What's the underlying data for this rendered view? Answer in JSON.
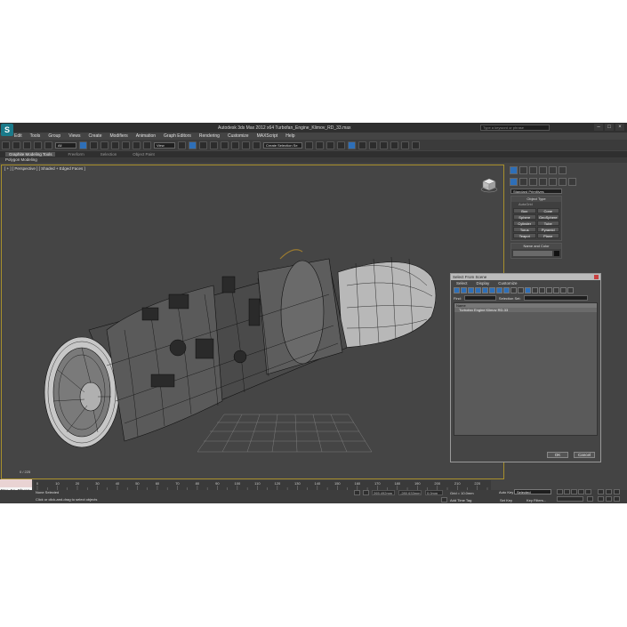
{
  "window": {
    "title": "Autodesk 3ds Max 2012 x64    Turbofan_Engine_Klimov_RD_33.max",
    "search_placeholder": "Type a keyword or phrase",
    "logo": "S"
  },
  "menu": [
    "Edit",
    "Tools",
    "Group",
    "Views",
    "Create",
    "Modifiers",
    "Animation",
    "Graph Editors",
    "Rendering",
    "Customize",
    "MAXScript",
    "Help"
  ],
  "toolbar": {
    "filter_dropdown": "All",
    "coord_dropdown": "View",
    "selection_set": "Create Selection Se"
  },
  "ribbon": {
    "tabs": [
      "Graphite Modeling Tools",
      "Freeform",
      "Selection",
      "Object Paint"
    ],
    "active_tab": 0,
    "sub_label": "Polygon Modeling"
  },
  "viewport": {
    "label": "[ + ] [ Perspective ] [ Shaded + Edged Faces ]",
    "frame_counter": "0 / 225"
  },
  "command_panel": {
    "category_dropdown": "Standard Primitives",
    "object_type_header": "Object Type",
    "autogrid": "AutoGrid",
    "buttons": [
      "Box",
      "Cone",
      "Sphere",
      "GeoSphere",
      "Cylinder",
      "Tube",
      "Torus",
      "Pyramid",
      "Teapot",
      "Plane"
    ],
    "name_color_header": "Name and Color"
  },
  "select_dialog": {
    "title": "Select From Scene",
    "menu": [
      "Select",
      "Display",
      "Customize"
    ],
    "find_label": "Find:",
    "selection_set_label": "Selection Set:",
    "column_header": "Name",
    "items": [
      "Turbofan Engine Klimov RD-33"
    ],
    "ok": "OK",
    "cancel": "Cancel"
  },
  "timeline": {
    "ticks": [
      "0",
      "10",
      "20",
      "30",
      "40",
      "50",
      "60",
      "70",
      "80",
      "90",
      "100",
      "110",
      "120",
      "130",
      "140",
      "150",
      "160",
      "170",
      "180",
      "190",
      "200",
      "210",
      "220"
    ]
  },
  "status": {
    "maxscript_text": "Max to Physc",
    "selection_info": "None Selected",
    "prompt": "Click or click-and-drag to select objects",
    "x_field": "265.492mm",
    "y_field": "-280.633mm",
    "z_field": "0.0mm",
    "grid": "Grid = 10.0mm",
    "add_time_tag": "Add Time Tag",
    "auto_key": "Auto Key",
    "auto_key_dropdown": "Selected",
    "set_key": "Set Key",
    "key_filters": "Key Filters..."
  }
}
